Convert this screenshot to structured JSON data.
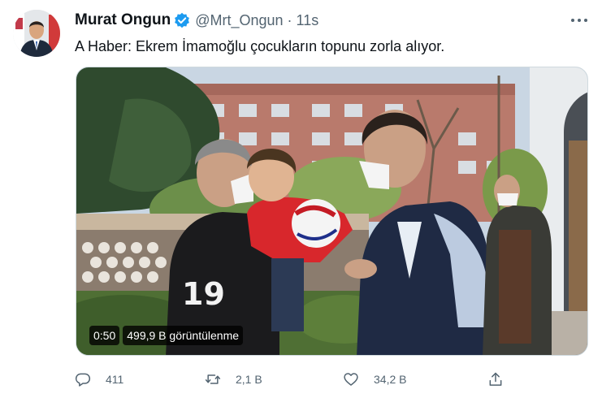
{
  "tweet": {
    "author": {
      "display_name": "Murat Ongun",
      "handle": "@Mrt_Ongun",
      "verified": true
    },
    "separator": "·",
    "time": "11s",
    "text": "A Haber: Ekrem İmamoğlu çocukların topunu zorla alıyor.",
    "media": {
      "kind": "video",
      "duration": "0:50",
      "views": "499,9 B görüntülenme"
    },
    "actions": {
      "replies": "411",
      "retweets": "2,1 B",
      "likes": "34,2 B"
    }
  },
  "icons": {
    "verified": "verified-badge-icon",
    "more": "more-horizontal-icon",
    "reply": "reply-icon",
    "retweet": "retweet-icon",
    "like": "heart-icon",
    "share": "share-icon"
  },
  "colors": {
    "text_primary": "#0f1419",
    "text_secondary": "#536471",
    "verified_blue": "#1d9bf0",
    "border": "#cfd9de"
  }
}
